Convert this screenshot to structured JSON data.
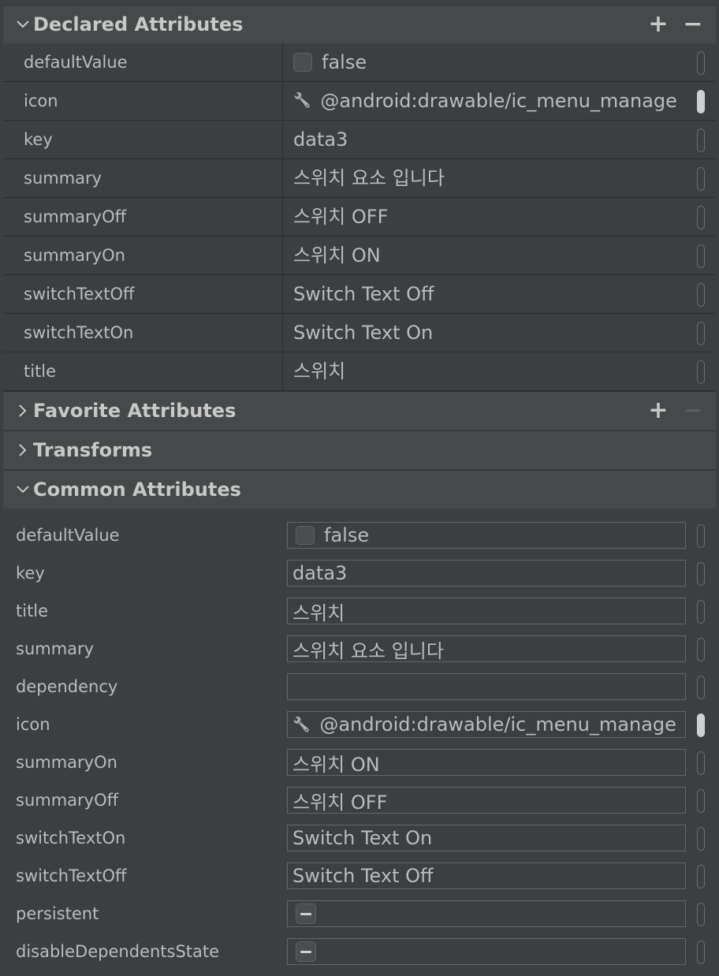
{
  "declared": {
    "title": "Declared Attributes",
    "add": "+",
    "remove": "−",
    "rows": [
      {
        "name": "defaultValue",
        "value": "false",
        "kind": "checkbox"
      },
      {
        "name": "icon",
        "value": "@android:drawable/ic_menu_manage",
        "kind": "icon"
      },
      {
        "name": "key",
        "value": "data3",
        "kind": "text"
      },
      {
        "name": "summary",
        "value": "스위치 요소 입니다",
        "kind": "text"
      },
      {
        "name": "summaryOff",
        "value": "스위치 OFF",
        "kind": "text"
      },
      {
        "name": "summaryOn",
        "value": "스위치 ON",
        "kind": "text"
      },
      {
        "name": "switchTextOff",
        "value": "Switch Text Off",
        "kind": "text"
      },
      {
        "name": "switchTextOn",
        "value": "Switch Text On",
        "kind": "text"
      },
      {
        "name": "title",
        "value": "스위치",
        "kind": "text"
      }
    ]
  },
  "favorite": {
    "title": "Favorite Attributes",
    "add": "+",
    "remove": "−"
  },
  "transforms": {
    "title": "Transforms"
  },
  "common": {
    "title": "Common Attributes",
    "rows": [
      {
        "name": "defaultValue",
        "value": "false",
        "kind": "checkbox"
      },
      {
        "name": "key",
        "value": "data3",
        "kind": "text"
      },
      {
        "name": "title",
        "value": "스위치",
        "kind": "text"
      },
      {
        "name": "summary",
        "value": "스위치 요소 입니다",
        "kind": "text"
      },
      {
        "name": "dependency",
        "value": "",
        "kind": "text"
      },
      {
        "name": "icon",
        "value": "@android:drawable/ic_menu_manage",
        "kind": "icon"
      },
      {
        "name": "summaryOn",
        "value": "스위치 ON",
        "kind": "text"
      },
      {
        "name": "summaryOff",
        "value": "스위치 OFF",
        "kind": "text"
      },
      {
        "name": "switchTextOn",
        "value": "Switch Text On",
        "kind": "text"
      },
      {
        "name": "switchTextOff",
        "value": "Switch Text Off",
        "kind": "text"
      },
      {
        "name": "persistent",
        "value": "",
        "kind": "tristate"
      },
      {
        "name": "disableDependentsState",
        "value": "",
        "kind": "tristate"
      }
    ]
  }
}
